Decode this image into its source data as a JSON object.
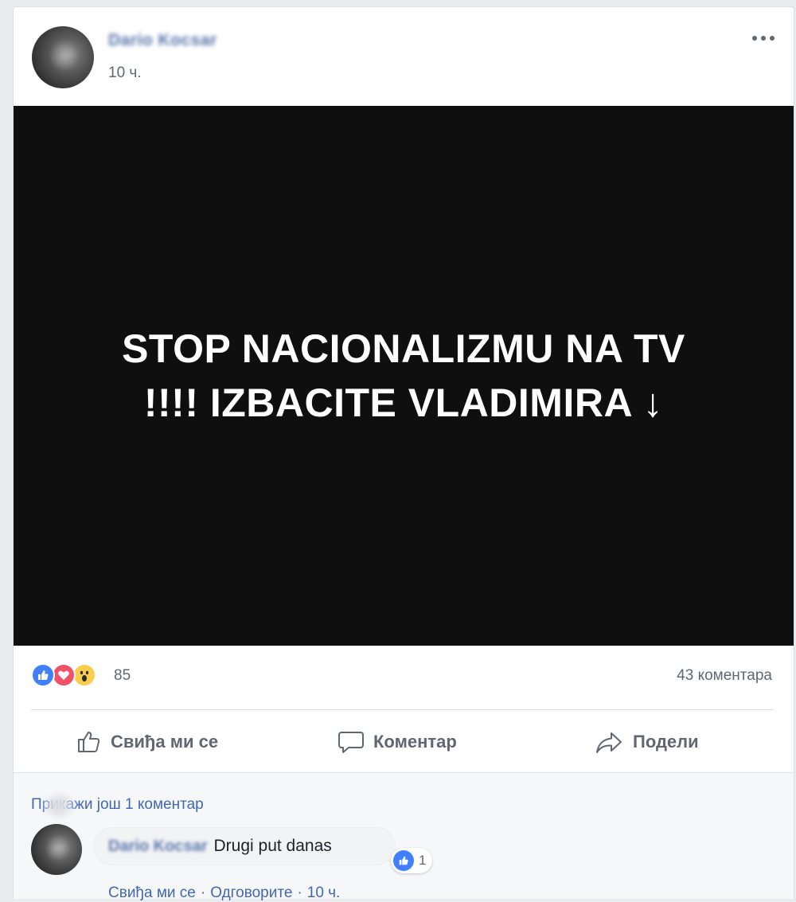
{
  "post": {
    "author_name": "Dario Kocsar",
    "timestamp": "10 ч."
  },
  "image": {
    "line1": "STOP NACIONALIZMU NA TV",
    "line2": "!!!! IZBACITE VLADIMIRA ↓"
  },
  "reactions": {
    "count": "85",
    "comments_count": "43 коментара"
  },
  "actions": {
    "like_label": "Свиђа ми се",
    "comment_label": "Коментар",
    "share_label": "Подели"
  },
  "comments": {
    "view_more_label": "Прикажи још 1 коментар",
    "item": {
      "author": "Dario Kocsar",
      "text": "Drugi put danas",
      "like_count": "1",
      "like_action": "Свиђа ми се",
      "separator": "·",
      "reply_action": "Одговорите",
      "time": "10 ч."
    }
  },
  "colors": {
    "link": "#4267b2",
    "author": "#365899",
    "muted": "#616770",
    "image_bg": "#0f0f10",
    "like_blue": "#4080ff",
    "love_red": "#f25268",
    "wow_yellow": "#fbcd4c"
  },
  "icons": [
    "more-icon",
    "like-reaction-icon",
    "love-reaction-icon",
    "wow-reaction-icon",
    "thumbs-up-icon",
    "comment-bubble-icon",
    "share-arrow-icon"
  ]
}
